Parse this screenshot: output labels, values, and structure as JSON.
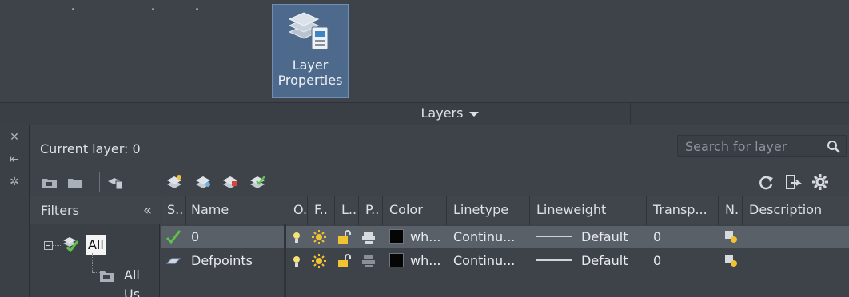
{
  "ribbon": {
    "layer_properties_label_line1": "Layer",
    "layer_properties_label_line2": "Properties",
    "panel_title": "Layers"
  },
  "palette": {
    "current_layer": "Current layer: 0",
    "search_placeholder": "Search for layer",
    "filters_label": "Filters",
    "filters_collapse": "«",
    "tree": {
      "root": "All",
      "child": "All Us"
    },
    "columns": [
      "S..",
      "Name",
      "O.",
      "F..",
      "L..",
      "P..",
      "Color",
      "Linetype",
      "Lineweight",
      "Transp...",
      "N.",
      "Description"
    ],
    "rows": [
      {
        "status": "current",
        "name": "0",
        "color": "wh...",
        "linetype": "Continu...",
        "lineweight": "Default",
        "transparency": "0",
        "description": "",
        "selected": true
      },
      {
        "status": "layer",
        "name": "Defpoints",
        "color": "wh...",
        "linetype": "Continu...",
        "lineweight": "Default",
        "transparency": "0",
        "description": "",
        "selected": false
      }
    ]
  },
  "colors": {
    "accent_button": "#4d6a8c",
    "selected_row": "#5a6068",
    "check_green": "#5fc04a"
  }
}
